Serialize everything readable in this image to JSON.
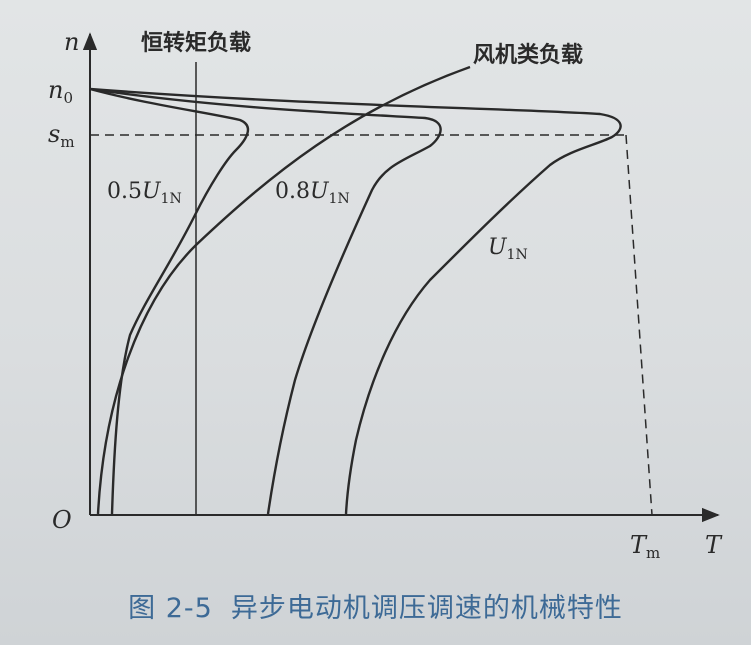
{
  "figure": {
    "caption_number": "图 2-5",
    "caption_title": "异步电动机调压调速的机械特性"
  },
  "axes": {
    "y_axis_label": "n",
    "x_axis_label": "T",
    "origin_label": "O",
    "n0_label": {
      "base": "n",
      "sub": "0"
    },
    "sm_label": {
      "base": "s",
      "sub": "m"
    },
    "tm_label": {
      "base": "T",
      "sub": "m"
    }
  },
  "curves": {
    "voltage_half": {
      "prefix": "0.5",
      "base": "U",
      "sub": "1N"
    },
    "voltage_eighty": {
      "prefix": "0.8",
      "base": "U",
      "sub": "1N"
    },
    "voltage_rated": {
      "prefix": "",
      "base": "U",
      "sub": "1N"
    }
  },
  "loads": {
    "constant_torque_label": "恒转矩负载",
    "fan_load_label": "风机类负载"
  },
  "colors": {
    "ink": "#2a2a2a",
    "caption": "#3d6a96"
  }
}
